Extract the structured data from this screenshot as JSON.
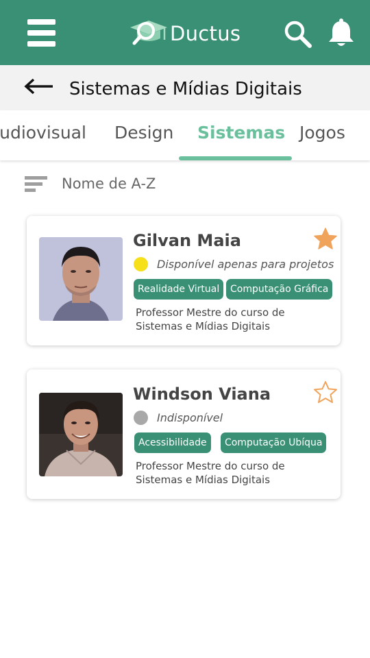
{
  "app": {
    "name": "Ductus"
  },
  "header": {
    "title": "Sistemas e Mídias Digitais"
  },
  "tabs": [
    {
      "label": "Audiovisual",
      "active": false
    },
    {
      "label": "Design",
      "active": false
    },
    {
      "label": "Sistemas",
      "active": true
    },
    {
      "label": "Jogos",
      "active": false
    }
  ],
  "sort": {
    "label": "Nome de A-Z"
  },
  "professors": [
    {
      "name": "Gilvan Maia",
      "status": "Disponível apenas para projetos",
      "status_color": "#f5e01a",
      "favorite": true,
      "tags": [
        "Realidade Virtual",
        "Computação Gráfica"
      ],
      "description": "Professor Mestre do curso de Sistemas e Mídias Digitais"
    },
    {
      "name": "Windson Viana",
      "status": "Indisponível",
      "status_color": "#a8a8a8",
      "favorite": false,
      "tags": [
        "Acessibilidade",
        "Computação Ubíqua"
      ],
      "description": "Professor Mestre do curso de Sistemas e Mídias Digitais"
    }
  ],
  "colors": {
    "primary": "#3a9074",
    "accent": "#6ac09c",
    "star": "#f0a35a"
  },
  "icons": [
    "menu-icon",
    "logo-icon",
    "search-icon",
    "bell-icon",
    "back-arrow-icon",
    "sort-icon",
    "star-filled-icon",
    "star-outline-icon"
  ]
}
